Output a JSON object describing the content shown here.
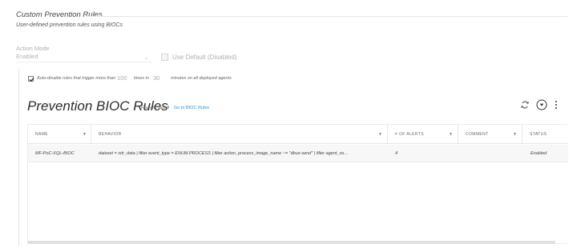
{
  "section": {
    "title": "Custom Prevention Rules",
    "subtitle": "User-defined prevention rules using BIOCs"
  },
  "action_mode": {
    "label": "Action Mode",
    "value": "Enabled",
    "use_default_label": "Use Default (Disabled)",
    "use_default_checked": false
  },
  "auto_disable": {
    "checked": true,
    "text_before": "Auto-disable rules that trigger more than",
    "count": "100",
    "text_middle": "times in",
    "minutes": "30",
    "text_after": "minutes on all deployed agents"
  },
  "rules": {
    "title": "Prevention BIOC Rules",
    "found": "Found 1 result",
    "link": "Go to BIOC Rules",
    "toolbar_icons": [
      "refresh-icon",
      "filter-icon",
      "more-options-icon"
    ],
    "columns": [
      {
        "label": "NAME"
      },
      {
        "label": "BEHAVIOR"
      },
      {
        "label": "# OF ALERTS"
      },
      {
        "label": "COMMENT"
      },
      {
        "label": "STATUS"
      }
    ],
    "rows": [
      {
        "name": "MF-PoC-XQL-BIOC",
        "behavior": "dataset = xdr_data | filter event_type = ENUM.PROCESS | filter action_process_image_name ~= \"dbus-send\" | filter agent_os...",
        "alerts": "4",
        "comment": "",
        "status": "Enabled"
      }
    ]
  }
}
